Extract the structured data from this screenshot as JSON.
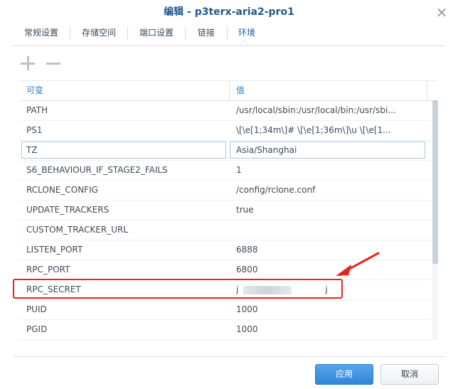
{
  "window": {
    "title": "编辑 - p3terx-aria2-pro1"
  },
  "tabs": [
    {
      "label": "常规设置"
    },
    {
      "label": "存储空间"
    },
    {
      "label": "端口设置"
    },
    {
      "label": "链接"
    },
    {
      "label": "环境"
    }
  ],
  "active_tab": "环境",
  "table": {
    "columns": [
      "可变",
      "值"
    ],
    "rows": [
      {
        "key": "PATH",
        "value": "/usr/local/sbin:/usr/local/bin:/usr/sbi..."
      },
      {
        "key": "PS1",
        "value": "\\[\\e[1;34m\\]# \\[\\e[1;36m\\]\\u \\[\\e[1..."
      },
      {
        "key": "TZ",
        "value": "Asia/Shanghai"
      },
      {
        "key": "S6_BEHAVIOUR_IF_STAGE2_FAILS",
        "value": "1"
      },
      {
        "key": "RCLONE_CONFIG",
        "value": "/config/rclone.conf"
      },
      {
        "key": "UPDATE_TRACKERS",
        "value": "true"
      },
      {
        "key": "CUSTOM_TRACKER_URL",
        "value": ""
      },
      {
        "key": "LISTEN_PORT",
        "value": "6888"
      },
      {
        "key": "RPC_PORT",
        "value": "6800"
      },
      {
        "key": "RPC_SECRET",
        "value": "j                                j"
      },
      {
        "key": "PUID",
        "value": "1000"
      },
      {
        "key": "PGID",
        "value": "1000"
      }
    ]
  },
  "buttons": {
    "apply": "应用",
    "cancel": "取消"
  },
  "colors": {
    "accent": "#2e7bc4",
    "highlight": "#e8251b",
    "primary_button": "#2f86d8"
  },
  "icons": {
    "add": "plus-icon",
    "remove": "minus-icon",
    "close": "close-icon"
  }
}
